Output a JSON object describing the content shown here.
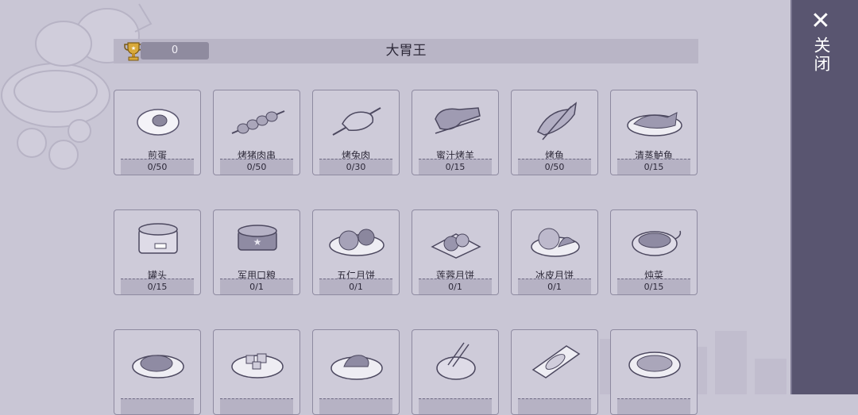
{
  "header": {
    "score": "0",
    "title": "大胃王"
  },
  "close": {
    "label": "关闭"
  },
  "foods": [
    {
      "name": "煎蛋",
      "count": "0/50",
      "icon": "fried-egg-icon"
    },
    {
      "name": "烤猪肉串",
      "count": "0/50",
      "icon": "pork-skewer-icon"
    },
    {
      "name": "烤兔肉",
      "count": "0/30",
      "icon": "roast-rabbit-icon"
    },
    {
      "name": "蜜汁烤羊",
      "count": "0/15",
      "icon": "honey-lamb-icon"
    },
    {
      "name": "烤鱼",
      "count": "0/50",
      "icon": "grilled-fish-icon"
    },
    {
      "name": "清蒸鲈鱼",
      "count": "0/15",
      "icon": "steamed-bass-icon"
    },
    {
      "name": "罐头",
      "count": "0/15",
      "icon": "canned-food-icon"
    },
    {
      "name": "军用口粮",
      "count": "0/1",
      "icon": "military-ration-icon"
    },
    {
      "name": "五仁月饼",
      "count": "0/1",
      "icon": "five-nut-mooncake-icon"
    },
    {
      "name": "莲蓉月饼",
      "count": "0/1",
      "icon": "lotus-mooncake-icon"
    },
    {
      "name": "冰皮月饼",
      "count": "0/1",
      "icon": "snowskin-mooncake-icon"
    },
    {
      "name": "炖菜",
      "count": "0/15",
      "icon": "stew-icon"
    },
    {
      "name": "",
      "count": "",
      "icon": "steak-icon"
    },
    {
      "name": "",
      "count": "",
      "icon": "tofu-dish-icon"
    },
    {
      "name": "",
      "count": "",
      "icon": "plated-meat-icon"
    },
    {
      "name": "",
      "count": "",
      "icon": "noodle-bowl-icon"
    },
    {
      "name": "",
      "count": "",
      "icon": "dumpling-plate-icon"
    },
    {
      "name": "",
      "count": "",
      "icon": "soup-plate-icon"
    }
  ]
}
